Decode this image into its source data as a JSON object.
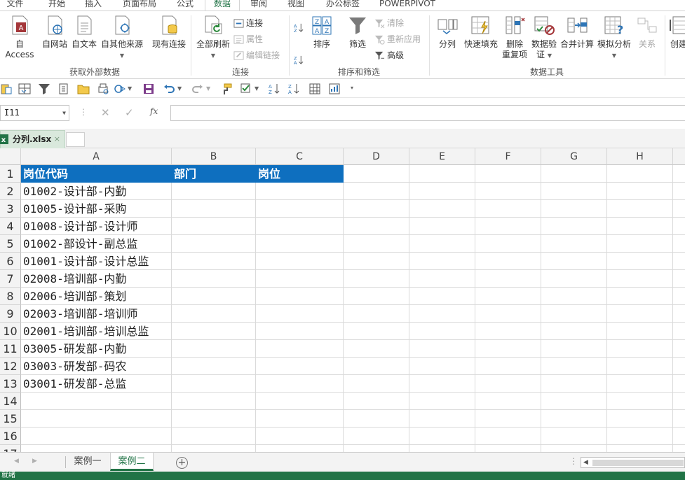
{
  "ribbon_tabs": [
    {
      "label": "文件",
      "state": "file"
    },
    {
      "label": "开始",
      "state": ""
    },
    {
      "label": "插入",
      "state": ""
    },
    {
      "label": "页面布局",
      "state": ""
    },
    {
      "label": "公式",
      "state": ""
    },
    {
      "label": "数据",
      "state": "active"
    },
    {
      "label": "审阅",
      "state": ""
    },
    {
      "label": "视图",
      "state": ""
    },
    {
      "label": "办公标签",
      "state": ""
    },
    {
      "label": "POWERPIVOT",
      "state": ""
    }
  ],
  "ribbon": {
    "external": {
      "group_label": "获取外部数据",
      "access": "自 Access",
      "web": "自网站",
      "text": "自文本",
      "other": "自其他来源",
      "existing": "现有连接"
    },
    "connections": {
      "group_label": "连接",
      "refresh_all": "全部刷新",
      "connect": "连接",
      "properties": "属性",
      "edit_links": "编辑链接"
    },
    "sort_filter": {
      "group_label": "排序和筛选",
      "sort": "排序",
      "filter": "筛选",
      "clear": "清除",
      "reapply": "重新应用",
      "advanced": "高级"
    },
    "data_tools": {
      "group_label": "数据工具",
      "split": "分列",
      "flash_fill": "快速填充",
      "remove_dup_1": "删除",
      "remove_dup_2": "重复项",
      "validation_1": "数据验",
      "validation_2": "证",
      "consolidate": "合并计算",
      "what_if": "模拟分析",
      "relationships": "关系"
    },
    "outline": {
      "create_group": "创建"
    }
  },
  "namebox": {
    "value": "I11"
  },
  "formula_buttons": {
    "cancel": "✕",
    "enter": "✓",
    "fx": "fx"
  },
  "document": {
    "tab_label": "分列.xlsx",
    "close": "×"
  },
  "columns": [
    {
      "label": ""
    },
    {
      "label": "A"
    },
    {
      "label": "B"
    },
    {
      "label": "C"
    },
    {
      "label": "D"
    },
    {
      "label": "E"
    },
    {
      "label": "F"
    },
    {
      "label": "G"
    },
    {
      "label": "H"
    },
    {
      "label": ""
    }
  ],
  "rows": [
    {
      "num": "1",
      "a": "岗位代码",
      "b": "部门",
      "c": "岗位"
    },
    {
      "num": "2",
      "a": "01002-设计部-内勤",
      "b": "",
      "c": ""
    },
    {
      "num": "3",
      "a": "01005-设计部-采购",
      "b": "",
      "c": ""
    },
    {
      "num": "4",
      "a": "01008-设计部-设计师",
      "b": "",
      "c": ""
    },
    {
      "num": "5",
      "a": "01002-部设计-副总监",
      "b": "",
      "c": ""
    },
    {
      "num": "6",
      "a": "01001-设计部-设计总监",
      "b": "",
      "c": ""
    },
    {
      "num": "7",
      "a": "02008-培训部-内勤",
      "b": "",
      "c": ""
    },
    {
      "num": "8",
      "a": "02006-培训部-策划",
      "b": "",
      "c": ""
    },
    {
      "num": "9",
      "a": "02003-培训部-培训师",
      "b": "",
      "c": ""
    },
    {
      "num": "10",
      "a": "02001-培训部-培训总监",
      "b": "",
      "c": ""
    },
    {
      "num": "11",
      "a": "03005-研发部-内勤",
      "b": "",
      "c": ""
    },
    {
      "num": "12",
      "a": "03003-研发部-码农",
      "b": "",
      "c": ""
    },
    {
      "num": "13",
      "a": "03001-研发部-总监",
      "b": "",
      "c": ""
    },
    {
      "num": "14",
      "a": "",
      "b": "",
      "c": ""
    },
    {
      "num": "15",
      "a": "",
      "b": "",
      "c": ""
    },
    {
      "num": "16",
      "a": "",
      "b": "",
      "c": ""
    },
    {
      "num": "17",
      "a": "",
      "b": "",
      "c": ""
    }
  ],
  "sheets": [
    {
      "label": "案例一",
      "active": false
    },
    {
      "label": "案例二",
      "active": true
    }
  ],
  "status": {
    "text": "就绪"
  },
  "colors": {
    "accent": "#217346",
    "header_fill": "#0e6fbf"
  }
}
